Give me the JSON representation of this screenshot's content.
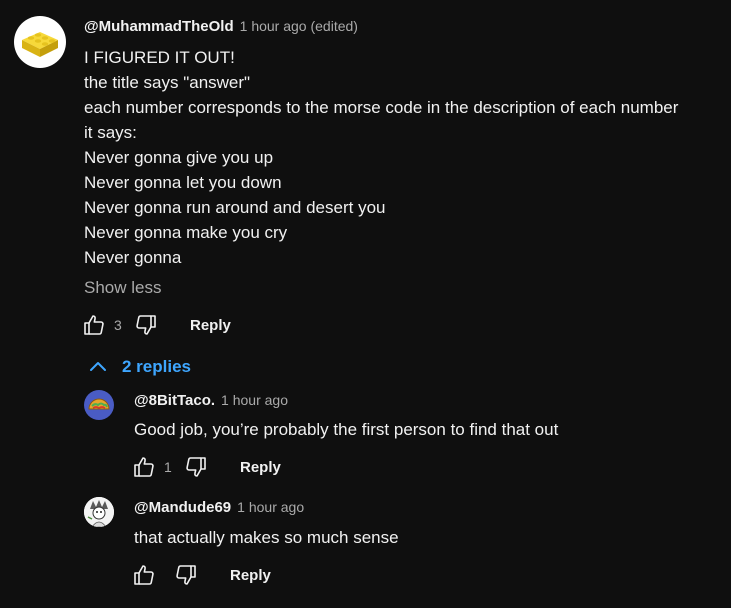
{
  "comment": {
    "author": "@MuhammadTheOld",
    "time": "1 hour ago (edited)",
    "lines": [
      "I FIGURED IT OUT!",
      "the title says \"answer\"",
      "each number corresponds to the morse code in the description of each number",
      "it says:",
      "Never gonna give you up",
      "Never gonna let you down",
      "Never gonna run around and desert you",
      "Never gonna make you cry",
      "Never gonna"
    ],
    "show_less": "Show less",
    "likes": "3",
    "reply_label": "Reply",
    "avatar_icon": "lego-brick-icon"
  },
  "replies_toggle": {
    "label": "2 replies",
    "icon": "chevron-up-icon"
  },
  "replies": [
    {
      "author": "@8BitTaco.",
      "time": "1 hour ago",
      "text": "Good job, you’re probably the first person to find that out",
      "likes": "1",
      "reply_label": "Reply",
      "avatar_icon": "taco-icon"
    },
    {
      "author": "@Mandude69",
      "time": "1 hour ago",
      "text": "that actually makes so much sense",
      "likes": "",
      "reply_label": "Reply",
      "avatar_icon": "character-avatar-icon"
    }
  ],
  "colors": {
    "background": "#0f0f0f",
    "text": "#f1f1f1",
    "secondary": "#aaaaaa",
    "link": "#3ea6ff",
    "lego": "#f2cf1e"
  }
}
